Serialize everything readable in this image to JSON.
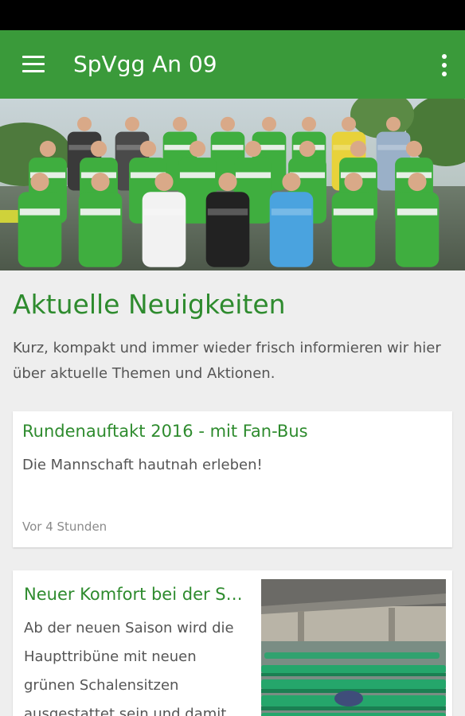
{
  "app_bar": {
    "title": "SpVgg An 09",
    "menu_icon": "hamburger-menu-icon",
    "overflow_icon": "more-vert-icon",
    "color": "#3a9a3a"
  },
  "hero": {
    "image": "team-photo"
  },
  "section": {
    "title": "Aktuelle Neuigkeiten",
    "description": "Kurz, kompakt und immer wieder frisch informieren wir hier über aktuelle Themen und Aktionen."
  },
  "news": [
    {
      "title": "Rundenauftakt 2016 - mit Fan-Bus",
      "excerpt": "Die Mannschaft hautnah erleben!",
      "time": "Vor 4 Stunden"
    },
    {
      "title": "Neuer Komfort bei der Saison",
      "excerpt": "Ab der neuen Saison wird die Haupttribüne mit neuen grünen Schalensitzen ausgestattet sein und damit",
      "image": "stadium-seats-photo"
    }
  ],
  "colors": {
    "accent": "#2e8b2e",
    "background": "#eeeeee",
    "jersey": "#3fae3f"
  }
}
